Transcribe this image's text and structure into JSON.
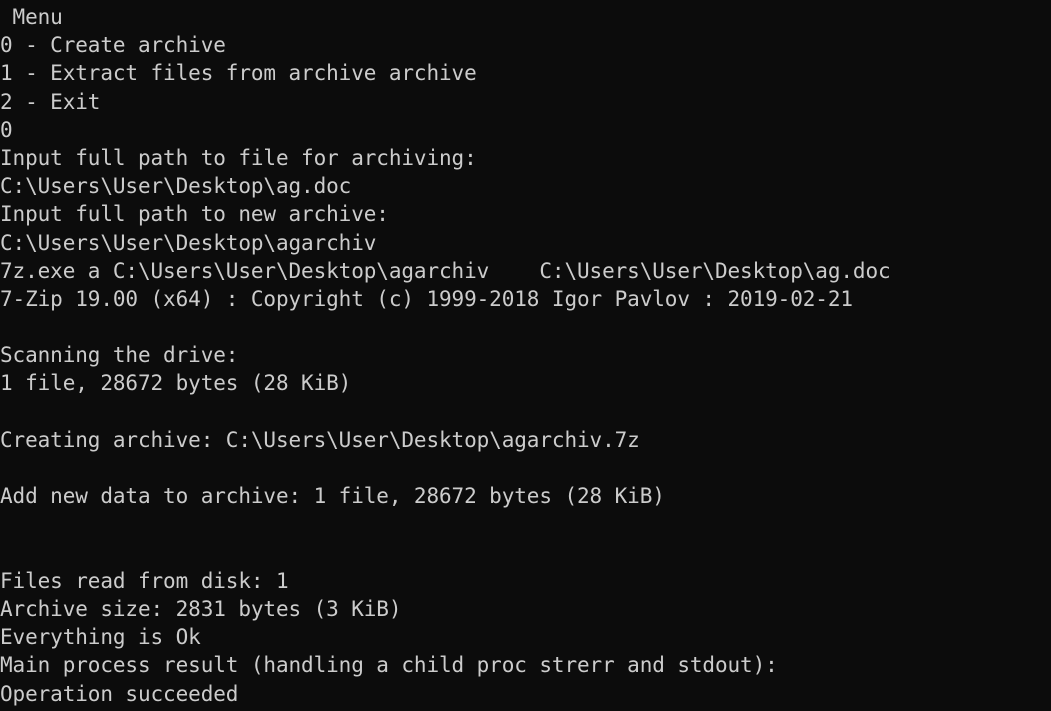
{
  "console": {
    "lines": [
      " Menu",
      "0 - Create archive",
      "1 - Extract files from archive archive",
      "2 - Exit",
      "0",
      "Input full path to file for archiving:",
      "C:\\Users\\User\\Desktop\\ag.doc",
      "Input full path to new archive:",
      "C:\\Users\\User\\Desktop\\agarchiv",
      "7z.exe a C:\\Users\\User\\Desktop\\agarchiv    C:\\Users\\User\\Desktop\\ag.doc",
      "7-Zip 19.00 (x64) : Copyright (c) 1999-2018 Igor Pavlov : 2019-02-21",
      "",
      "Scanning the drive:",
      "1 file, 28672 bytes (28 KiB)",
      "",
      "Creating archive: C:\\Users\\User\\Desktop\\agarchiv.7z",
      "",
      "Add new data to archive: 1 file, 28672 bytes (28 KiB)",
      "",
      "",
      "Files read from disk: 1",
      "Archive size: 2831 bytes (3 KiB)",
      "Everything is Ok",
      "Main process result (handling a child proc strerr and stdout):",
      "Operation succeeded"
    ]
  },
  "colors": {
    "background": "#0c0c0c",
    "text": "#cccccc"
  }
}
